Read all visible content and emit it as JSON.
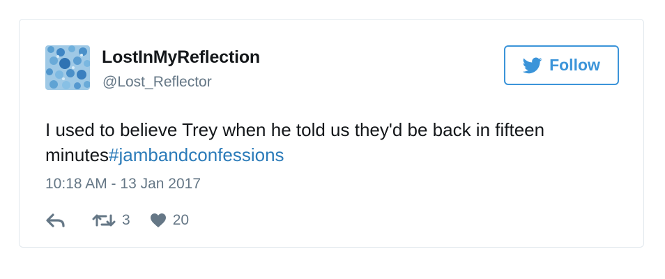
{
  "tweet": {
    "author_name": "LostInMyReflection",
    "author_handle": "@Lost_Reflector",
    "follow_label": "Follow",
    "text": "I used to believe Trey when he told us they'd be back in fifteen minutes",
    "hashtag": "#jambandconfessions",
    "timestamp": "10:18 AM - 13 Jan 2017",
    "retweet_count": "3",
    "like_count": "20"
  },
  "icons": {
    "follow": "twitter-bird-icon",
    "reply": "reply-icon",
    "retweet": "retweet-icon",
    "like": "heart-icon"
  },
  "colors": {
    "accent": "#3b94d9",
    "hashtag": "#2b7bb9",
    "muted": "#657786",
    "text": "#14171a",
    "border": "#e1e8ed"
  }
}
